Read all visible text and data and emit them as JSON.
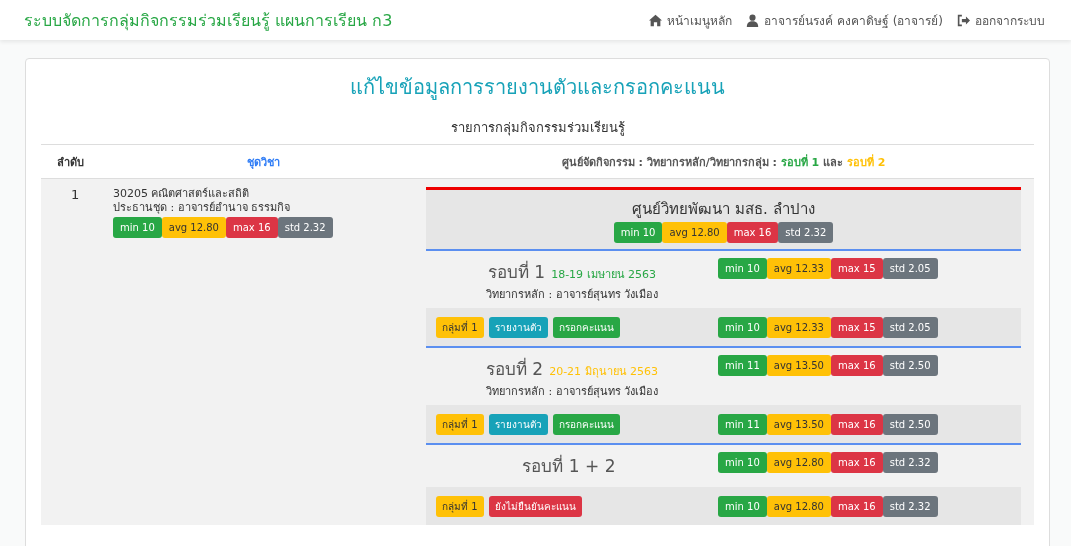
{
  "navbar": {
    "brand": "ระบบจัดการกลุ่มกิจกรรมร่วมเรียนรู้ แผนการเรียน ก3",
    "links": [
      {
        "kind": "home",
        "label": "หน้าเมนูหลัก"
      },
      {
        "kind": "user",
        "label": "อาจารย์นรงค์ คงคาดิษฐ์ (อาจารย์)"
      },
      {
        "kind": "logout",
        "label": "ออกจากระบบ"
      }
    ]
  },
  "page_title": "แก้ไขข้อมูลการรายงานตัวและกรอกคะแนน",
  "subtitle": "รายการกลุ่มกิจกรรมร่วมเรียนรู้",
  "table": {
    "columns": [
      {
        "segments": [
          {
            "text": "ลำดับ",
            "color": "#333333"
          }
        ]
      },
      {
        "segments": [
          {
            "text": "ชุดวิชา",
            "color": "#2e7cf6"
          }
        ]
      },
      {
        "segments": [
          {
            "text": "ศูนย์จัดกิจกรรม : วิทยากรหลัก/วิทยากรกลุ่ม : ",
            "color": "#555555"
          },
          {
            "text": "รอบที่ 1",
            "color": "#28a745"
          },
          {
            "text": " และ ",
            "color": "#555555"
          },
          {
            "text": "รอบที่ 2",
            "color": "#ffc107"
          }
        ]
      }
    ],
    "rows": [
      {
        "index": "1",
        "subject": "30205 คณิตศาสตร์และสถิติ",
        "chair": "ประธานชุด : อาจารย์อำนาจ ธรรมกิจ",
        "stats": [
          {
            "kind": "min",
            "text": "min 10"
          },
          {
            "kind": "avg",
            "text": "avg 12.80"
          },
          {
            "kind": "max",
            "text": "max 16"
          },
          {
            "kind": "std",
            "text": "std 2.32"
          }
        ],
        "center": {
          "name": "ศูนย์วิทยพัฒนา มสธ. ลำปาง",
          "stats": [
            {
              "kind": "min",
              "text": "min 10"
            },
            {
              "kind": "avg",
              "text": "avg 12.80"
            },
            {
              "kind": "max",
              "text": "max 16"
            },
            {
              "kind": "std",
              "text": "std 2.32"
            }
          ]
        },
        "rounds": [
          {
            "title": "รอบที่ 1",
            "date": {
              "text": "18-19 เมษายน 2563",
              "color": "#28a745"
            },
            "speaker": "วิทยากรหลัก : อาจารย์สุนทร วังเมือง",
            "stats": [
              {
                "kind": "min",
                "text": "min 10"
              },
              {
                "kind": "avg",
                "text": "avg 12.33"
              },
              {
                "kind": "max",
                "text": "max 15"
              },
              {
                "kind": "std",
                "text": "std 2.05"
              }
            ],
            "groups": [
              {
                "badges": [
                  {
                    "kind": "group",
                    "text": "กลุ่มที่ 1"
                  },
                  {
                    "kind": "report",
                    "text": "รายงานตัว"
                  },
                  {
                    "kind": "score",
                    "text": "กรอกคะแนน"
                  }
                ],
                "stats": [
                  {
                    "kind": "min",
                    "text": "min 10"
                  },
                  {
                    "kind": "avg",
                    "text": "avg 12.33"
                  },
                  {
                    "kind": "max",
                    "text": "max 15"
                  },
                  {
                    "kind": "std",
                    "text": "std 2.05"
                  }
                ]
              }
            ]
          },
          {
            "title": "รอบที่ 2",
            "date": {
              "text": "20-21 มิถุนายน 2563",
              "color": "#ffc107"
            },
            "speaker": "วิทยากรหลัก : อาจารย์สุนทร วังเมือง",
            "stats": [
              {
                "kind": "min",
                "text": "min 11"
              },
              {
                "kind": "avg",
                "text": "avg 13.50"
              },
              {
                "kind": "max",
                "text": "max 16"
              },
              {
                "kind": "std",
                "text": "std 2.50"
              }
            ],
            "groups": [
              {
                "badges": [
                  {
                    "kind": "group",
                    "text": "กลุ่มที่ 1"
                  },
                  {
                    "kind": "report",
                    "text": "รายงานตัว"
                  },
                  {
                    "kind": "score",
                    "text": "กรอกคะแนน"
                  }
                ],
                "stats": [
                  {
                    "kind": "min",
                    "text": "min 11"
                  },
                  {
                    "kind": "avg",
                    "text": "avg 13.50"
                  },
                  {
                    "kind": "max",
                    "text": "max 16"
                  },
                  {
                    "kind": "std",
                    "text": "std 2.50"
                  }
                ]
              }
            ]
          },
          {
            "title": "รอบที่ 1 + 2",
            "stats": [
              {
                "kind": "min",
                "text": "min 10"
              },
              {
                "kind": "avg",
                "text": "avg 12.80"
              },
              {
                "kind": "max",
                "text": "max 16"
              },
              {
                "kind": "std",
                "text": "std 2.32"
              }
            ],
            "groups": [
              {
                "badges": [
                  {
                    "kind": "group",
                    "text": "กลุ่มที่ 1"
                  },
                  {
                    "kind": "unconfirmed",
                    "text": "ยังไม่ยืนยันคะแนน"
                  }
                ],
                "stats": [
                  {
                    "kind": "min",
                    "text": "min 10"
                  },
                  {
                    "kind": "avg",
                    "text": "avg 12.80"
                  },
                  {
                    "kind": "max",
                    "text": "max 16"
                  },
                  {
                    "kind": "std",
                    "text": "std 2.32"
                  }
                ]
              }
            ]
          }
        ]
      }
    ]
  }
}
